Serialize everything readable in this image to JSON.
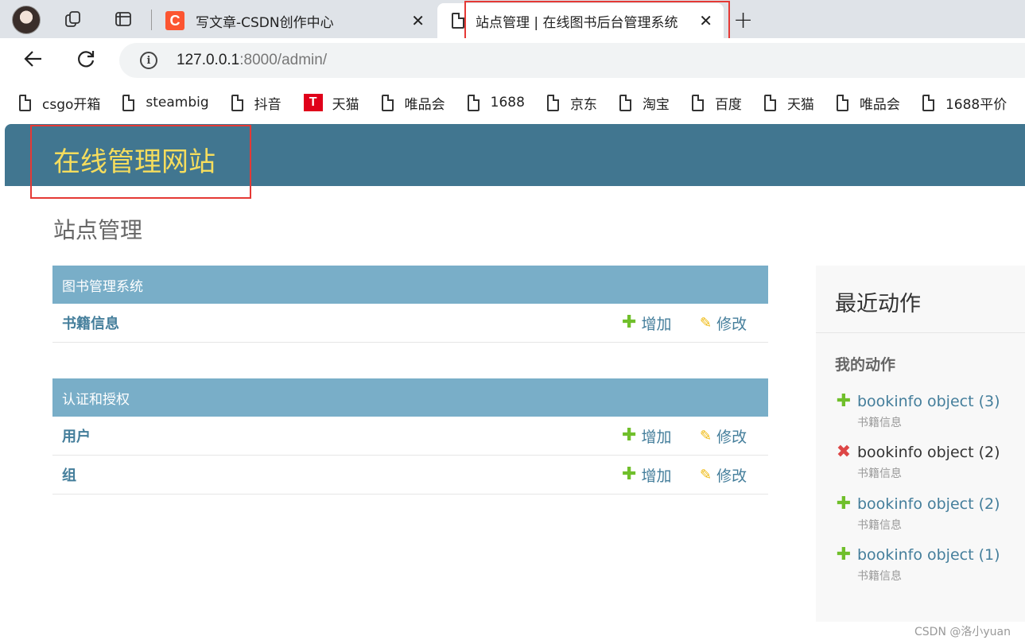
{
  "browser": {
    "tabs": [
      {
        "title": "写文章-CSDN创作中心",
        "favicon": "csdn-logo",
        "favicon_text": "C"
      },
      {
        "title": "站点管理 | 在线图书后台管理系统",
        "favicon": "document-icon",
        "active": true
      }
    ],
    "url_host": "127.0.0.1",
    "url_rest": ":8000/admin/",
    "bookmarks": [
      {
        "label": "csgo开箱",
        "icon": "document-icon"
      },
      {
        "label": "steambig",
        "icon": "document-icon"
      },
      {
        "label": "抖音",
        "icon": "document-icon"
      },
      {
        "label": "天猫",
        "icon": "tmall-icon",
        "icon_text": "T"
      },
      {
        "label": "唯品会",
        "icon": "document-icon"
      },
      {
        "label": "1688",
        "icon": "document-icon"
      },
      {
        "label": "京东",
        "icon": "document-icon"
      },
      {
        "label": "淘宝",
        "icon": "document-icon"
      },
      {
        "label": "百度",
        "icon": "document-icon"
      },
      {
        "label": "天猫",
        "icon": "document-icon"
      },
      {
        "label": "唯品会",
        "icon": "document-icon"
      },
      {
        "label": "1688平价",
        "icon": "document-icon"
      }
    ]
  },
  "admin": {
    "site_name": "在线管理网站",
    "page_title": "站点管理",
    "modules": [
      {
        "caption": "图书管理系统",
        "models": [
          {
            "name": "书籍信息",
            "add": "增加",
            "change": "修改"
          }
        ]
      },
      {
        "caption": "认证和授权",
        "models": [
          {
            "name": "用户",
            "add": "增加",
            "change": "修改"
          },
          {
            "name": "组",
            "add": "增加",
            "change": "修改"
          }
        ]
      }
    ],
    "recent": {
      "title": "最近动作",
      "subtitle": "我的动作",
      "actions": [
        {
          "type": "addition",
          "object": "bookinfo object (3)",
          "ctype": "书籍信息"
        },
        {
          "type": "deletion",
          "object": "bookinfo object (2)",
          "ctype": "书籍信息"
        },
        {
          "type": "addition",
          "object": "bookinfo object (2)",
          "ctype": "书籍信息"
        },
        {
          "type": "addition",
          "object": "bookinfo object (1)",
          "ctype": "书籍信息"
        }
      ]
    }
  },
  "watermark": "CSDN @洛小yuan",
  "colors": {
    "header_bg": "#417690",
    "site_name": "#f5dd5d",
    "module_caption_bg": "#79aec8",
    "link": "#447e9b",
    "add_green": "#70bf2b",
    "delete_red": "#dd4646",
    "pencil_yellow": "#efb80b",
    "highlight_box": "#e53935"
  }
}
